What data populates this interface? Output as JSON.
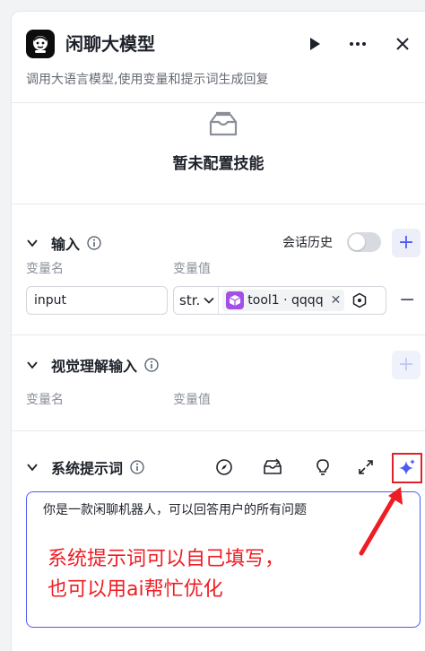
{
  "header": {
    "title": "闲聊大模型",
    "subtitle": "调用大语言模型,使用变量和提示词生成回复"
  },
  "skills": {
    "empty_text": "暂未配置技能"
  },
  "input_section": {
    "title": "输入",
    "history_label": "会话历史",
    "history_enabled": false,
    "col_name": "变量名",
    "col_value": "变量值",
    "rows": [
      {
        "name": "input",
        "type": "str.",
        "ref_label": "tool1 · qqqq"
      }
    ]
  },
  "vision_section": {
    "title": "视觉理解输入",
    "col_name": "变量名",
    "col_value": "变量值"
  },
  "system_prompt": {
    "title": "系统提示词",
    "text": "你是一款闲聊机器人，可以回答用户的所有问题"
  },
  "annotation": {
    "line1": "系统提示词可以自己填写，",
    "line2": "也可以用ai帮忙优化"
  },
  "colors": {
    "accent": "#4e5bf2",
    "annotation": "#ee1d24",
    "tag_icon": "#a24ee8"
  }
}
